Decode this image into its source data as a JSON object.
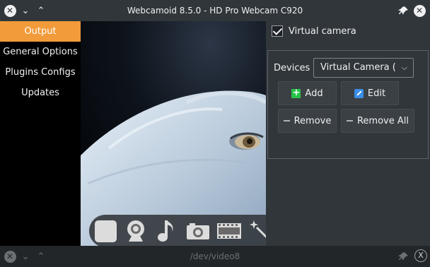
{
  "window": {
    "title": "Webcamoid 8.5.0 - HD Pro Webcam C920",
    "close_icon": "close-icon",
    "minimize_icon": "chevron-down-icon",
    "maximize_icon": "chevron-up-icon",
    "pin_icon": "pin-icon",
    "accent_color": "#f29b3a"
  },
  "sidebar": {
    "items": [
      {
        "label": "Output",
        "active": true
      },
      {
        "label": "General Options",
        "active": false
      },
      {
        "label": "Plugins Configs",
        "active": false
      },
      {
        "label": "Updates",
        "active": false
      }
    ]
  },
  "panel": {
    "virtual_camera": {
      "label": "Virtual camera",
      "checked": true
    },
    "devices_label": "Devices",
    "devices_selected": "Virtual Camera (",
    "buttons": {
      "add": "Add",
      "edit": "Edit",
      "remove": "Remove",
      "remove_all": "Remove All"
    }
  },
  "toolbar": {
    "icons": [
      "stop-icon",
      "webcam-icon",
      "music-note-icon",
      "camera-icon",
      "film-strip-icon",
      "magic-wand-icon",
      "gear-icon",
      "info-icon"
    ]
  },
  "bottom_window": {
    "title": "/dev/video8"
  }
}
